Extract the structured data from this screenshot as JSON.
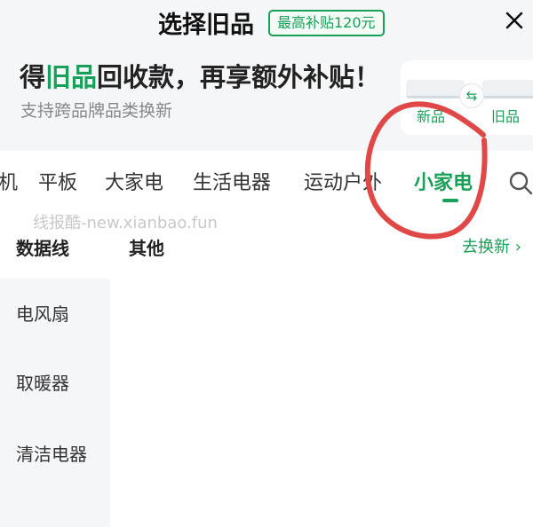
{
  "header": {
    "title": "选择旧品",
    "badge": "最高补贴120元"
  },
  "banner": {
    "headline_prefix": "得",
    "headline_highlight": "旧品",
    "headline_suffix": "回收款，再享额外补贴！",
    "subline": "支持跨品牌品类换新",
    "new_label": "新品",
    "old_label": "旧品"
  },
  "tabs": [
    {
      "label": "机"
    },
    {
      "label": "平板"
    },
    {
      "label": "大家电"
    },
    {
      "label": "生活电器"
    },
    {
      "label": "运动户外"
    },
    {
      "label": "小家电"
    }
  ],
  "active_tab_index": 5,
  "watermark": "线报酷-new.xianbao.fun",
  "subcategory": {
    "sidebar_selected": "数据线",
    "main_title": "其他",
    "link": "去换新 ›"
  },
  "sidebar": {
    "items": [
      "电风扇",
      "取暖器",
      "清洁电器"
    ]
  },
  "colors": {
    "accent": "#18a058",
    "annotation": "#e04848",
    "panel_bg": "#f4f6f8"
  },
  "icons": [
    "close-icon",
    "swap-icon",
    "search-icon"
  ]
}
